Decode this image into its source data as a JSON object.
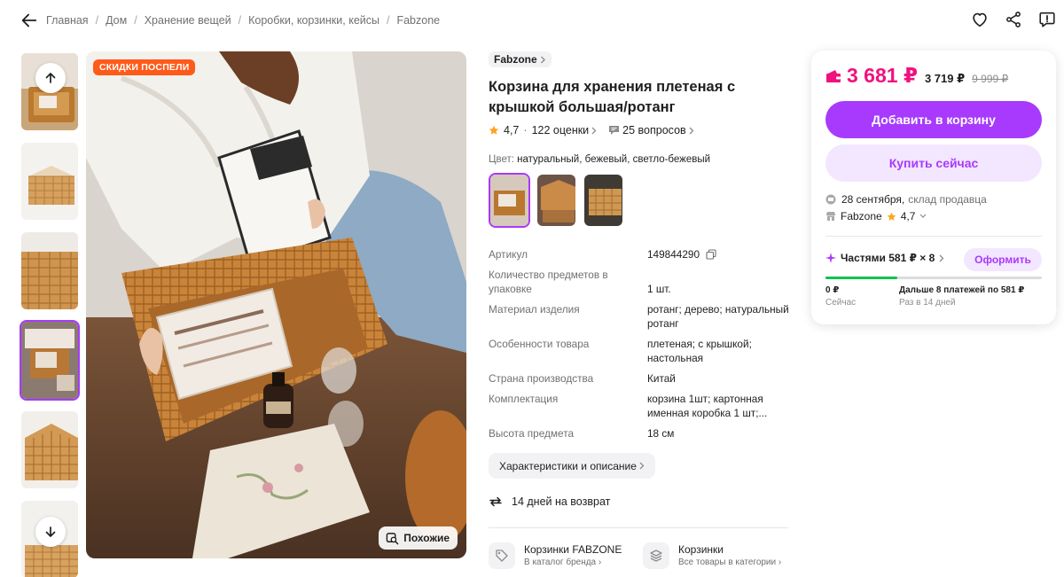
{
  "breadcrumbs": [
    "Главная",
    "Дом",
    "Хранение вещей",
    "Коробки, корзинки, кейсы",
    "Fabzone"
  ],
  "icons": {
    "back": "arrow-left-icon",
    "favorite": "heart-icon",
    "share": "share-icon",
    "report": "report-icon"
  },
  "gallery": {
    "badge": "СКИДКИ ПОСПЕЛИ",
    "similar_label": "Похожие",
    "thumbnail_count": 6,
    "active_thumbnail": 4
  },
  "product": {
    "brand": "Fabzone",
    "title": "Корзина для хранения плетеная с крышкой большая/ротанг",
    "rating": "4,7",
    "rating_sep": "·",
    "reviews": "122 оценки",
    "questions": "25 вопросов",
    "color_label": "Цвет:",
    "color_value": "натуральный, бежевый, светло-бежевый"
  },
  "specs": [
    {
      "name": "Артикул",
      "value": "149844290"
    },
    {
      "name": "Количество предметов в упаковке",
      "value": "1 шт."
    },
    {
      "name": "Материал изделия",
      "value": "ротанг; дерево; натуральный ротанг"
    },
    {
      "name": "Особенности товара",
      "value": "плетеная; с крышкой; настольная"
    },
    {
      "name": "Страна производства",
      "value": "Китай"
    },
    {
      "name": "Комплектация",
      "value": "корзина 1шт; картонная именная коробка 1 шт;..."
    },
    {
      "name": "Высота предмета",
      "value": "18 см"
    }
  ],
  "characteristics_button": "Характеристики и описание",
  "returns": "14 дней на возврат",
  "categories": [
    {
      "title": "Корзинки FABZONE",
      "subtitle": "В каталог бренда"
    },
    {
      "title": "Корзинки",
      "subtitle": "Все товары в категории"
    }
  ],
  "buy": {
    "price": "3 681 ₽",
    "price_card": "3 719 ₽",
    "price_old": "9 999 ₽",
    "add_to_cart": "Добавить в корзину",
    "buy_now": "Купить сейчас",
    "delivery_date": "28 сентября,",
    "delivery_source": "склад продавца",
    "seller": "Fabzone",
    "seller_rating": "4,7",
    "installments": "Частями 581 ₽ × 8",
    "order_button": "Оформить",
    "progress_fraction": 0.33,
    "pay_now_amount": "0 ₽",
    "pay_now_note": "Сейчас",
    "pay_later_amount": "Дальше 8 платежей по 581 ₽",
    "pay_later_note": "Раз в 14 дней"
  },
  "colors": {
    "accent": "#a73afd",
    "price": "#f1117e",
    "badge": "#ff5a19",
    "progress": "#10c44c"
  }
}
